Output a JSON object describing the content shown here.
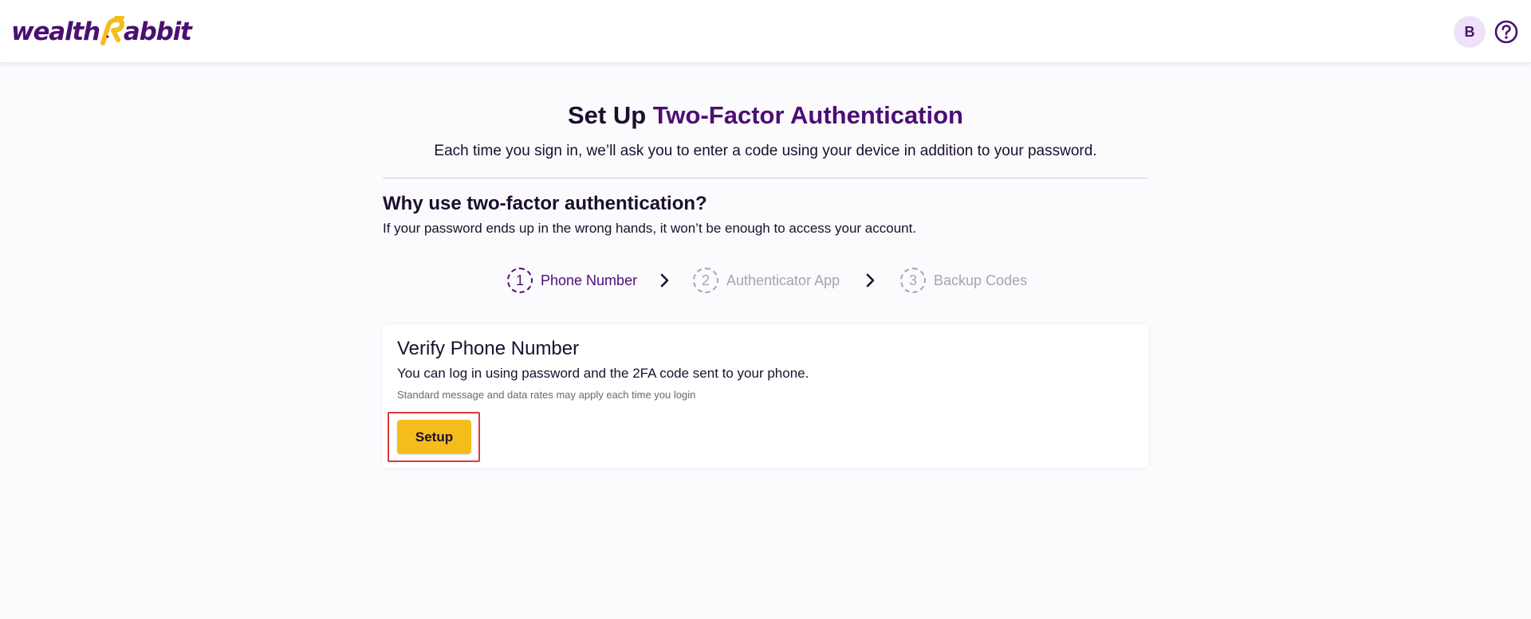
{
  "header": {
    "logo_text_left": "wealth",
    "logo_text_right": "abbit",
    "avatar_initial": "B"
  },
  "colors": {
    "brand_purple": "#4b0f73",
    "accent_yellow": "#f4bd1c",
    "highlight_red": "#e0383d",
    "page_bg": "#fbfafd"
  },
  "main": {
    "title_prefix": "Set Up ",
    "title_accent": "Two-Factor Authentication",
    "subtitle": "Each time you sign in, we’ll ask you to enter a code using your device in addition to your password.",
    "why_title": "Why use two-factor authentication?",
    "why_desc": "If your password ends up in the wrong hands, it won’t be enough to access your account."
  },
  "steps": [
    {
      "number": "1",
      "label": "Phone Number",
      "state": "active"
    },
    {
      "number": "2",
      "label": "Authenticator App",
      "state": "inactive"
    },
    {
      "number": "3",
      "label": "Backup Codes",
      "state": "inactive"
    }
  ],
  "card": {
    "title": "Verify Phone Number",
    "description": "You can log in using password and the 2FA code sent to your phone.",
    "note": "Standard message and data rates may apply each time you login",
    "setup_label": "Setup"
  },
  "icons": {
    "help": "question-circle-icon",
    "step_separator": "chevron-right-icon"
  }
}
